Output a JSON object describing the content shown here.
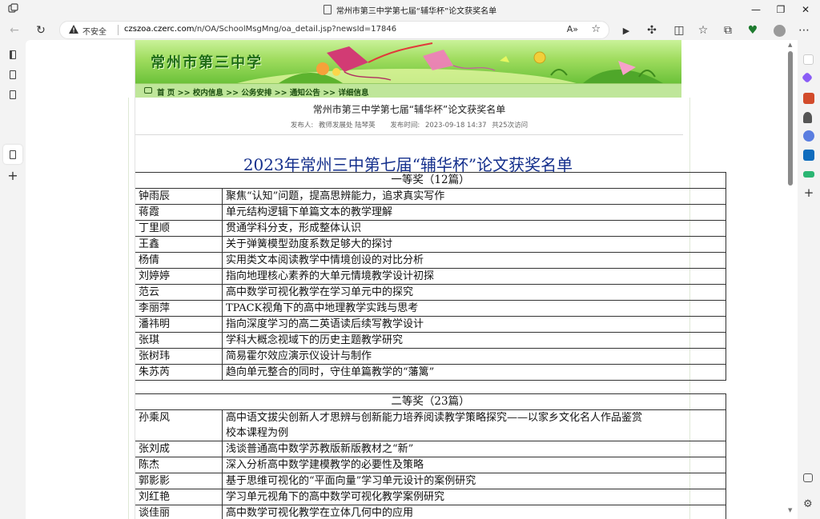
{
  "window": {
    "title": "常州市第三中学第七届“辅华杯”论文获奖名单"
  },
  "address": {
    "security_label": "不安全",
    "url_domain": "czszoa.czerc.com",
    "url_path": "/n/OA/SchoolMsgMng/oa_detail.jsp?newsId=17846",
    "read_aloud": "A»"
  },
  "site": {
    "school_name": "常州市第三中学",
    "breadcrumb": "首 页 >> 校内信息 >> 公务安排 >> 通知公告 >> 详细信息"
  },
  "article": {
    "title": "常州市第三中学第七届“辅华杯”论文获奖名单",
    "publisher_label": "发布人:",
    "publisher": "教师发展处 陆琴英",
    "time_label": "发布时间:",
    "time": "2023-09-18 14:37",
    "views": "共25次访问"
  },
  "list": {
    "main_title": "2023年常州三中第七届“辅华杯”论文获奖名单",
    "first_header": "一等奖（12篇）",
    "first": [
      {
        "name": "钟雨辰",
        "title": "聚焦“认知”问题，提高思辨能力，追求真实写作"
      },
      {
        "name": "蒋霞",
        "title": "单元结构逻辑下单篇文本的教学理解"
      },
      {
        "name": "丁里顺",
        "title": "贯通学科分支，形成整体认识"
      },
      {
        "name": "王鑫",
        "title": "关于弹簧模型劲度系数足够大的探讨"
      },
      {
        "name": "杨倩",
        "title": "实用类文本阅读教学中情境创设的对比分析"
      },
      {
        "name": "刘婷婷",
        "title": "指向地理核心素养的大单元情境教学设计初探"
      },
      {
        "name": "范云",
        "title": "高中数学可视化教学在学习单元中的探究"
      },
      {
        "name": "李丽萍",
        "title": "TPACK视角下的高中地理教学实践与思考"
      },
      {
        "name": "潘祎明",
        "title": "指向深度学习的高二英语读后续写教学设计"
      },
      {
        "name": "张琪",
        "title": "学科大概念视域下的历史主题教学研究"
      },
      {
        "name": "张树玮",
        "title": "简易霍尔效应演示仪设计与制作"
      },
      {
        "name": "朱苏芮",
        "title": "趋向单元整合的同时，守住单篇教学的“藩篱”"
      }
    ],
    "second_header": "二等奖（23篇）",
    "second": [
      {
        "name": "孙乘风",
        "title": "高中语文拔尖创新人才思辨与创新能力培养阅读教学策略探究——以家乡文化名人作品鉴赏",
        "title2": "校本课程为例"
      },
      {
        "name": "张刘成",
        "title": "浅谈普通高中数学苏教版新版教材之“新”"
      },
      {
        "name": "陈杰",
        "title": "深入分析高中数学建模教学的必要性及策略"
      },
      {
        "name": "郭影影",
        "title": "基于思维可视化的“平面向量”学习单元设计的案例研究"
      },
      {
        "name": "刘红艳",
        "title": "学习单元视角下的高中数学可视化教学案例研究"
      },
      {
        "name": "谈佳丽",
        "title": "高中数学可视化教学在立体几何中的应用"
      }
    ]
  },
  "colors": {
    "banner_green": "#9fdc5e",
    "title_blue": "#142f8c",
    "crumb_green": "#bfe69a"
  }
}
